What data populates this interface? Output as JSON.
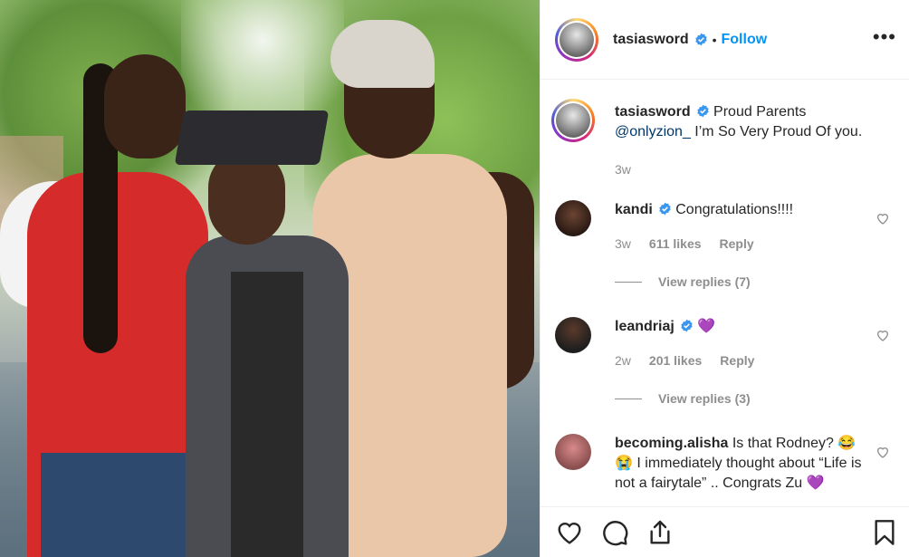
{
  "post": {
    "author": "tasiasword",
    "follow_label": "Follow",
    "separator": "•",
    "more_label": "•••"
  },
  "caption": {
    "username": "tasiasword",
    "text_part1": "Proud Parents",
    "mention": "@onlyzion_",
    "text_part2": " I’m So Very Proud Of you.",
    "time": "3w"
  },
  "comments": [
    {
      "username": "kandi",
      "verified": true,
      "text": "Congratulations!!!!",
      "time": "3w",
      "likes": "611 likes",
      "reply_label": "Reply",
      "view_replies": "View replies (7)"
    },
    {
      "username": "leandriaj",
      "verified": true,
      "text": "💜",
      "time": "2w",
      "likes": "201 likes",
      "reply_label": "Reply",
      "view_replies": "View replies (3)"
    },
    {
      "username": "becoming.alisha",
      "verified": false,
      "text": "Is that Rodney? 😂😭 I immediately thought about “Life is not a fairytale” .. Congrats Zu 💜"
    }
  ],
  "icons": {
    "verified": "verified-badge-icon",
    "like": "heart-icon",
    "comment": "comment-icon",
    "share": "share-icon",
    "save": "bookmark-icon"
  },
  "colors": {
    "link_blue": "#0095f6",
    "verified_blue": "#3897f0",
    "text": "#262626",
    "muted": "#8e8e8e"
  }
}
